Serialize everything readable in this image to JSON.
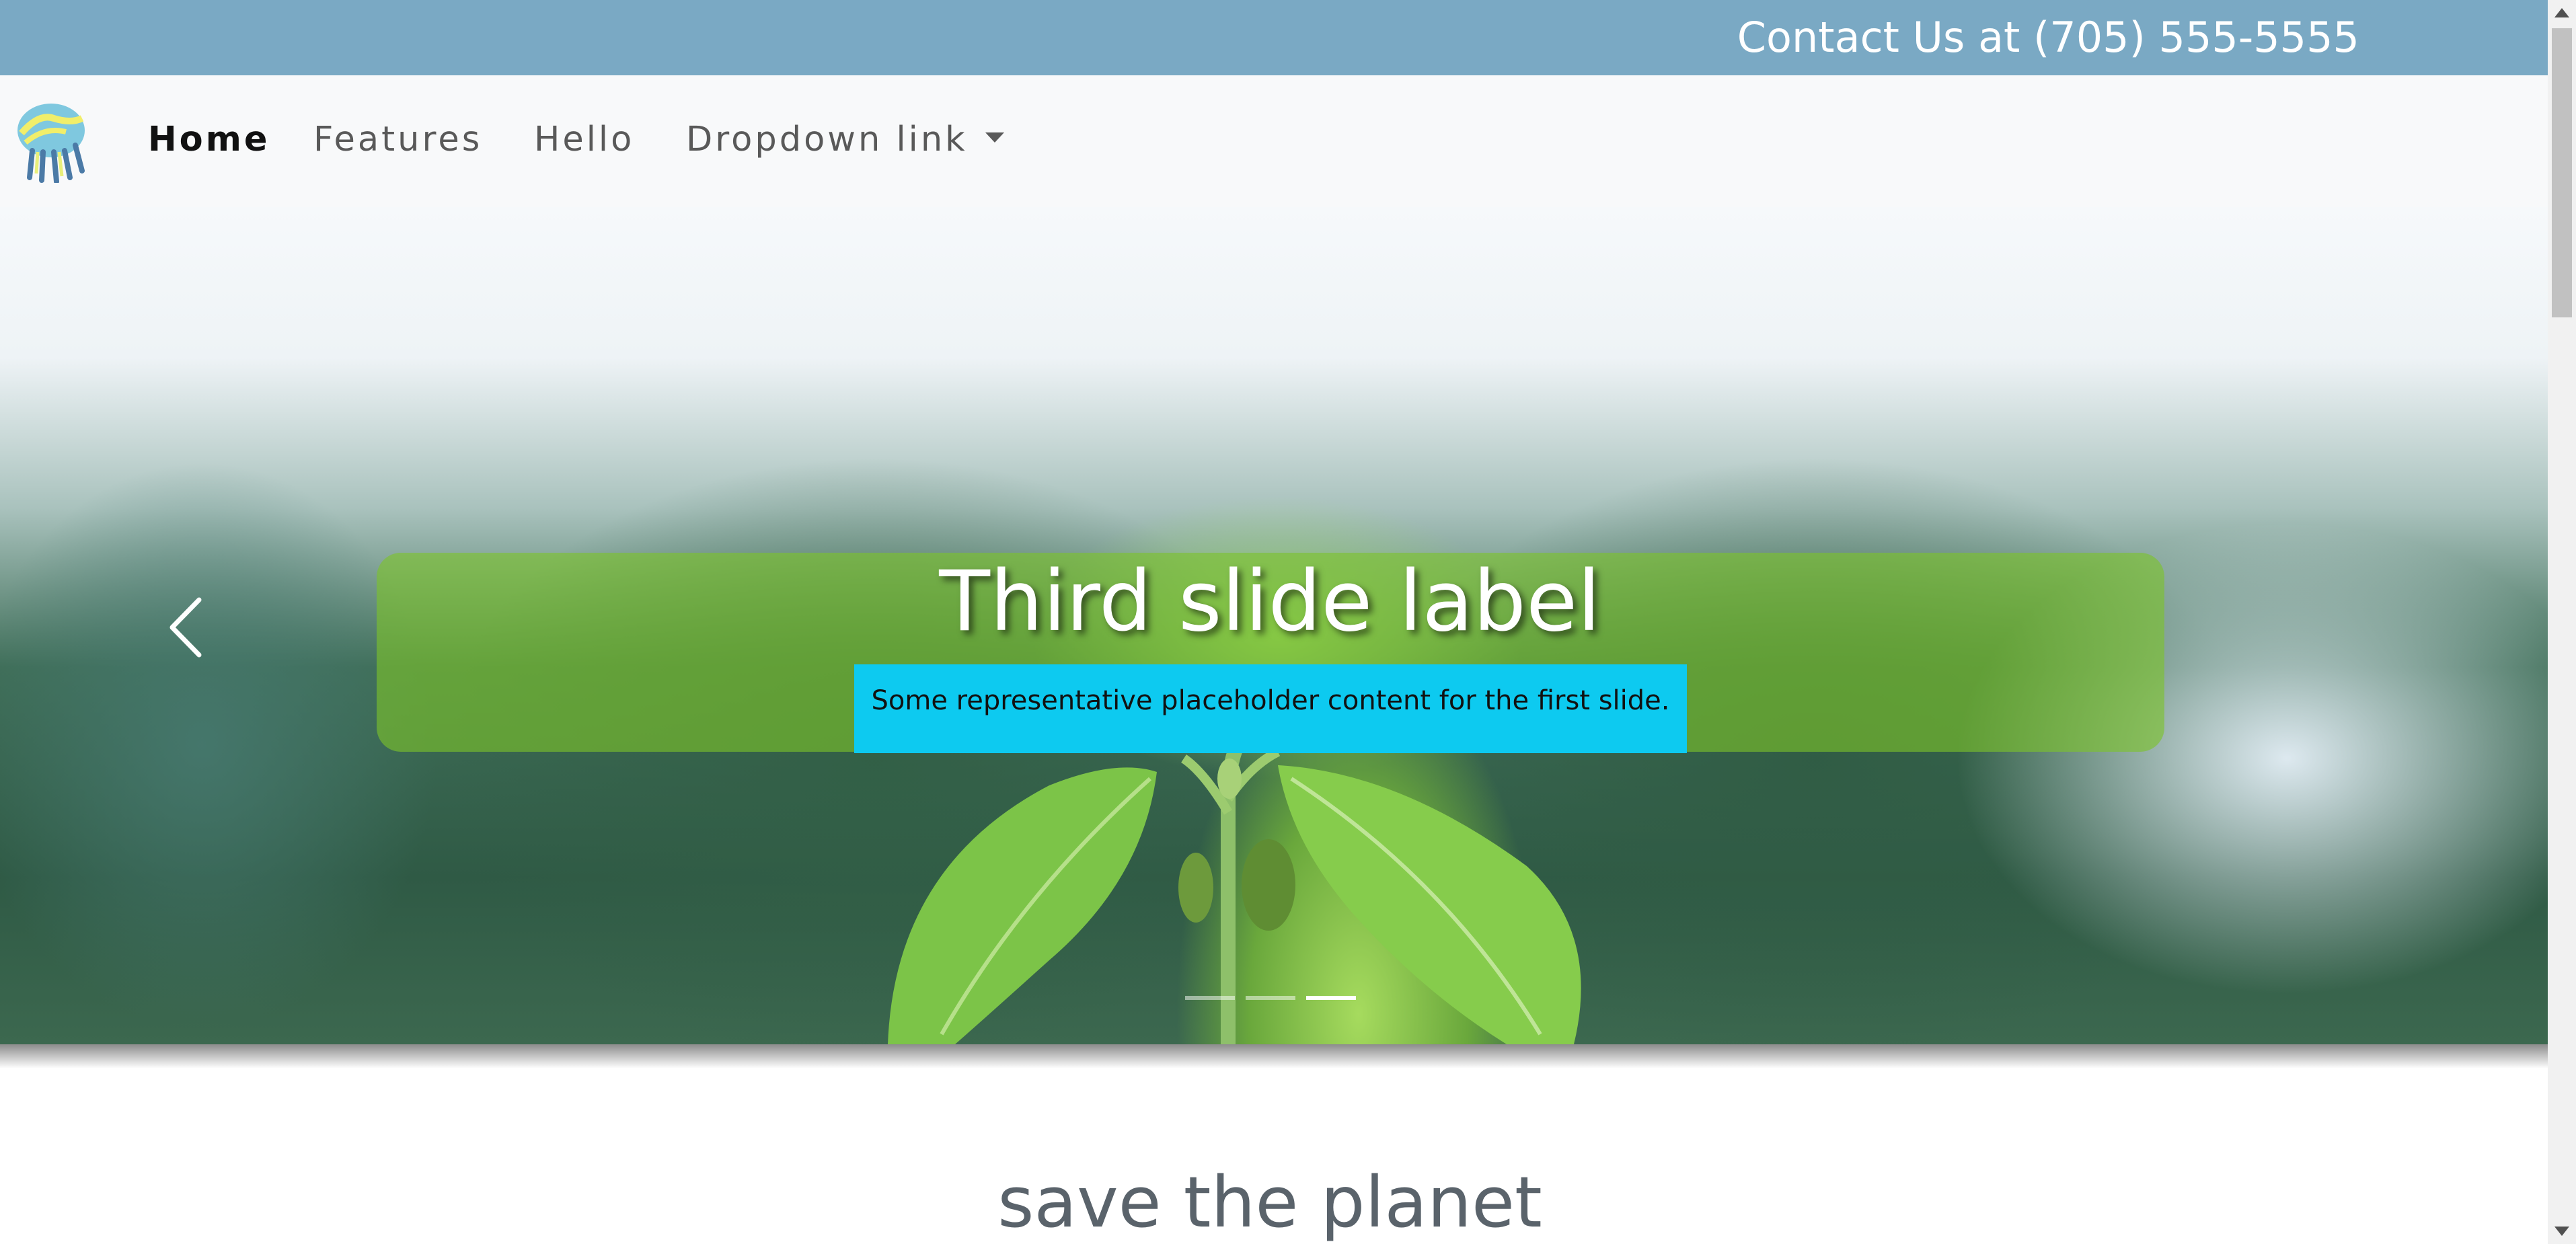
{
  "topbar": {
    "contact_text": "Contact Us at (705) 555-5555"
  },
  "navbar": {
    "logo_icon": "jellyfish-logo-icon",
    "items": [
      {
        "label": "Home",
        "active": true
      },
      {
        "label": "Features",
        "active": false
      },
      {
        "label": "Hello",
        "active": false
      },
      {
        "label": "Dropdown link",
        "active": false,
        "has_dropdown": true
      }
    ]
  },
  "carousel": {
    "slide_title": "Third slide label",
    "slide_text": "Some representative placeholder content for the first slide.",
    "prev_icon": "chevron-left-icon",
    "active_slide": 3,
    "slide_count": 3,
    "caption_bg_color": "#7cc42a",
    "caption_text_bg_color": "#0dcaf0"
  },
  "section": {
    "title": "save the planet"
  },
  "colors": {
    "topbar_bg": "#7aa9c4",
    "navbar_bg": "#f8f9fa",
    "section_title": "#5a636b"
  }
}
